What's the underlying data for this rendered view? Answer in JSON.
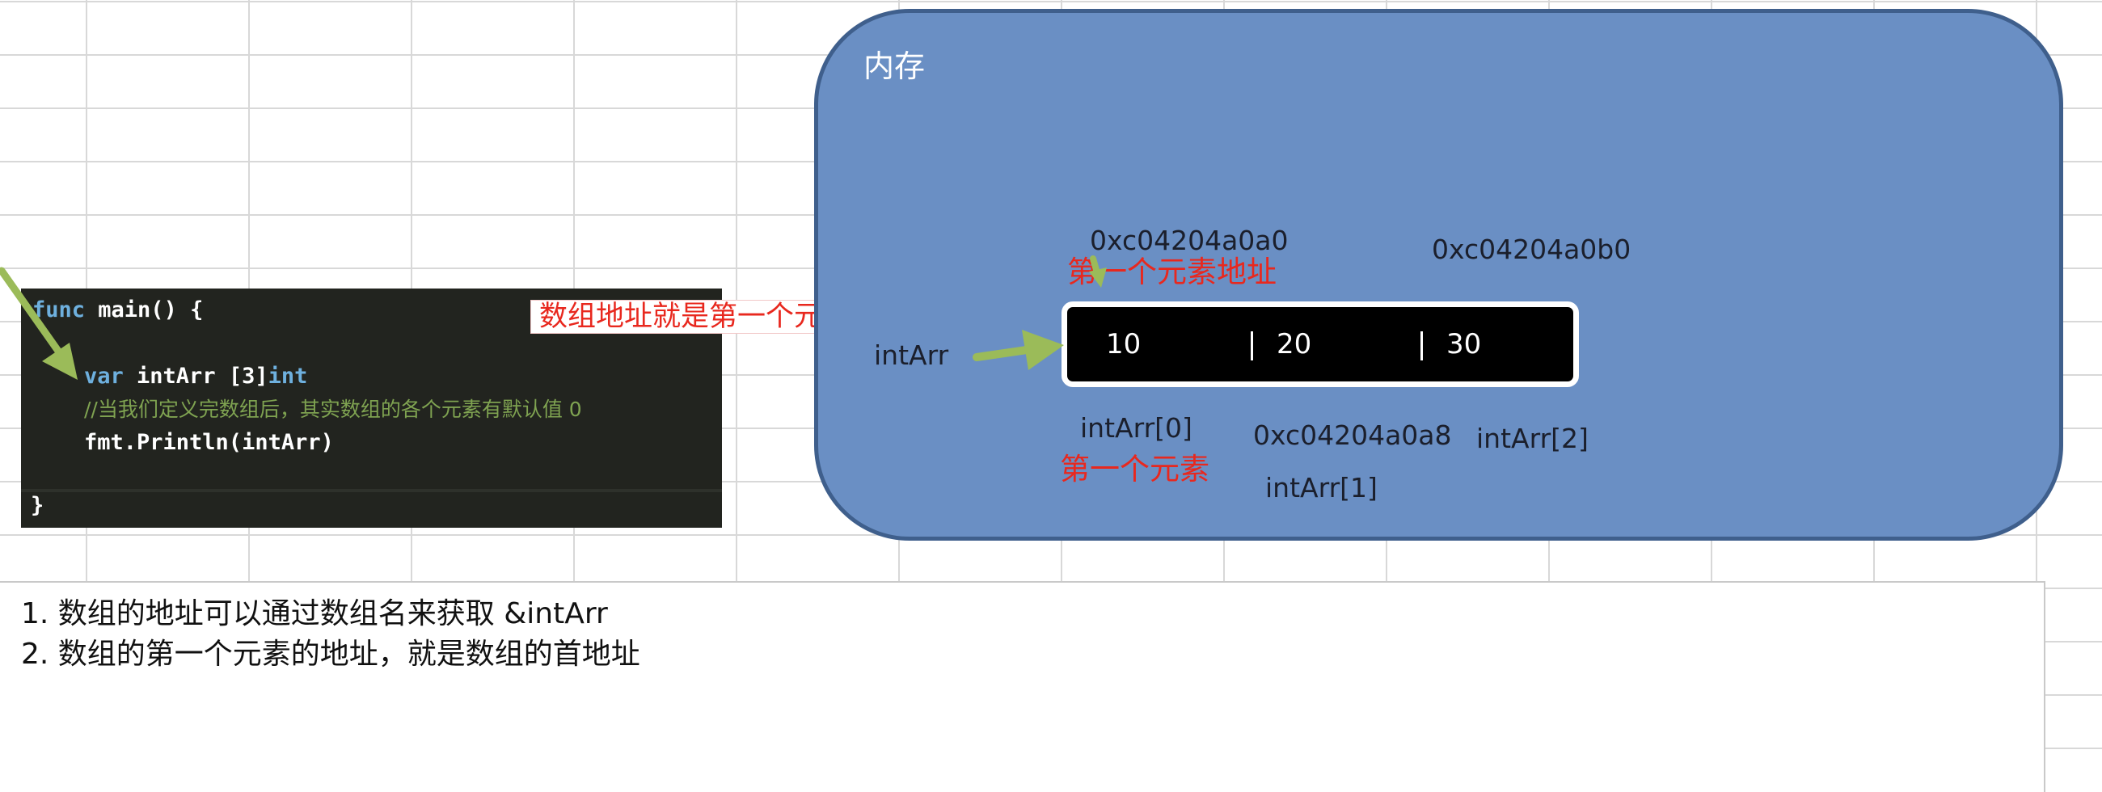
{
  "code": {
    "line1": {
      "kw": "func",
      "rest": " main() {"
    },
    "line2": {
      "kw": "var",
      "name": " intArr ",
      "type_prefix": "[3]",
      "type": "int"
    },
    "line3": "//当我们定义完数组后，其实数组的各个元素有默认值 0",
    "line4": "fmt.Println(intArr)",
    "line5": "}"
  },
  "caption_array_address": "数组地址就是第一个元素地址",
  "memory": {
    "title": "内存",
    "var_label": "intArr",
    "addr_0": "0xc04204a0a0",
    "addr_0_note": "第一个元素地址",
    "addr_1": "0xc04204a0a8",
    "addr_2": "0xc04204a0b0",
    "cells": [
      "10",
      "20",
      "30"
    ],
    "index_0": "intArr[0]",
    "index_0_note": "第一个元素",
    "index_1": "intArr[1]",
    "index_2": "intArr[2]"
  },
  "notes": [
    "1. 数组的地址可以通过数组名来获取 &intArr",
    "2. 数组的第一个元素的地址，就是数组的首地址"
  ],
  "colors": {
    "panel_fill": "#6a8fc4",
    "annotation_red": "#e8281e",
    "arrow_green": "#9bbb59"
  }
}
